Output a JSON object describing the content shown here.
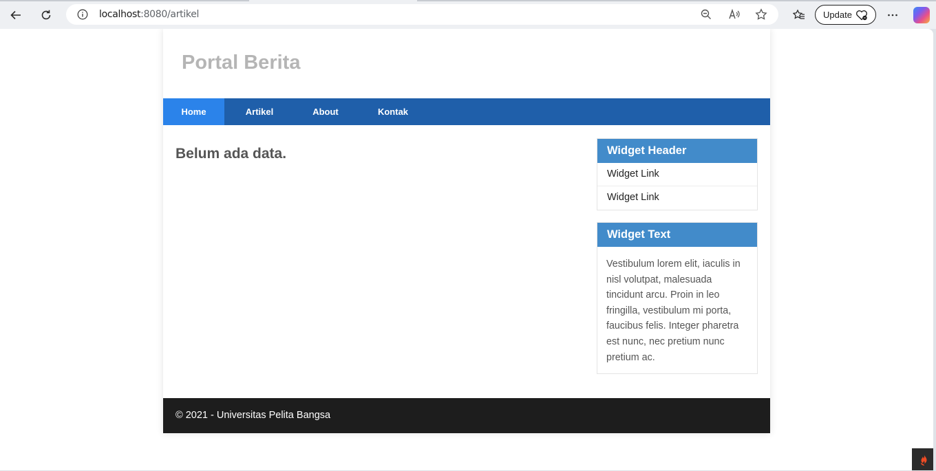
{
  "browser": {
    "url_host": "localhost",
    "url_rest": ":8080/artikel",
    "update_label": "Update"
  },
  "site": {
    "title": "Portal Berita",
    "nav": [
      {
        "label": "Home",
        "active": true
      },
      {
        "label": "Artikel"
      },
      {
        "label": "About"
      },
      {
        "label": "Kontak"
      }
    ],
    "main_message": "Belum ada data.",
    "widget_links": {
      "header": "Widget Header",
      "links": [
        "Widget Link",
        "Widget Link"
      ]
    },
    "widget_text": {
      "header": "Widget Text",
      "body": "Vestibulum lorem elit, iaculis in nisl volutpat, malesuada tincidunt arcu. Proin in leo fringilla, vestibulum mi porta, faucibus felis. Integer pharetra est nunc, nec pretium nunc pretium ac."
    },
    "footer": "© 2021 - Universitas Pelita Bangsa"
  },
  "colors": {
    "nav_bg": "#1f5faa",
    "nav_active": "#2b83ea",
    "widget_header": "#428bca",
    "footer_bg": "#1d1d1d"
  }
}
